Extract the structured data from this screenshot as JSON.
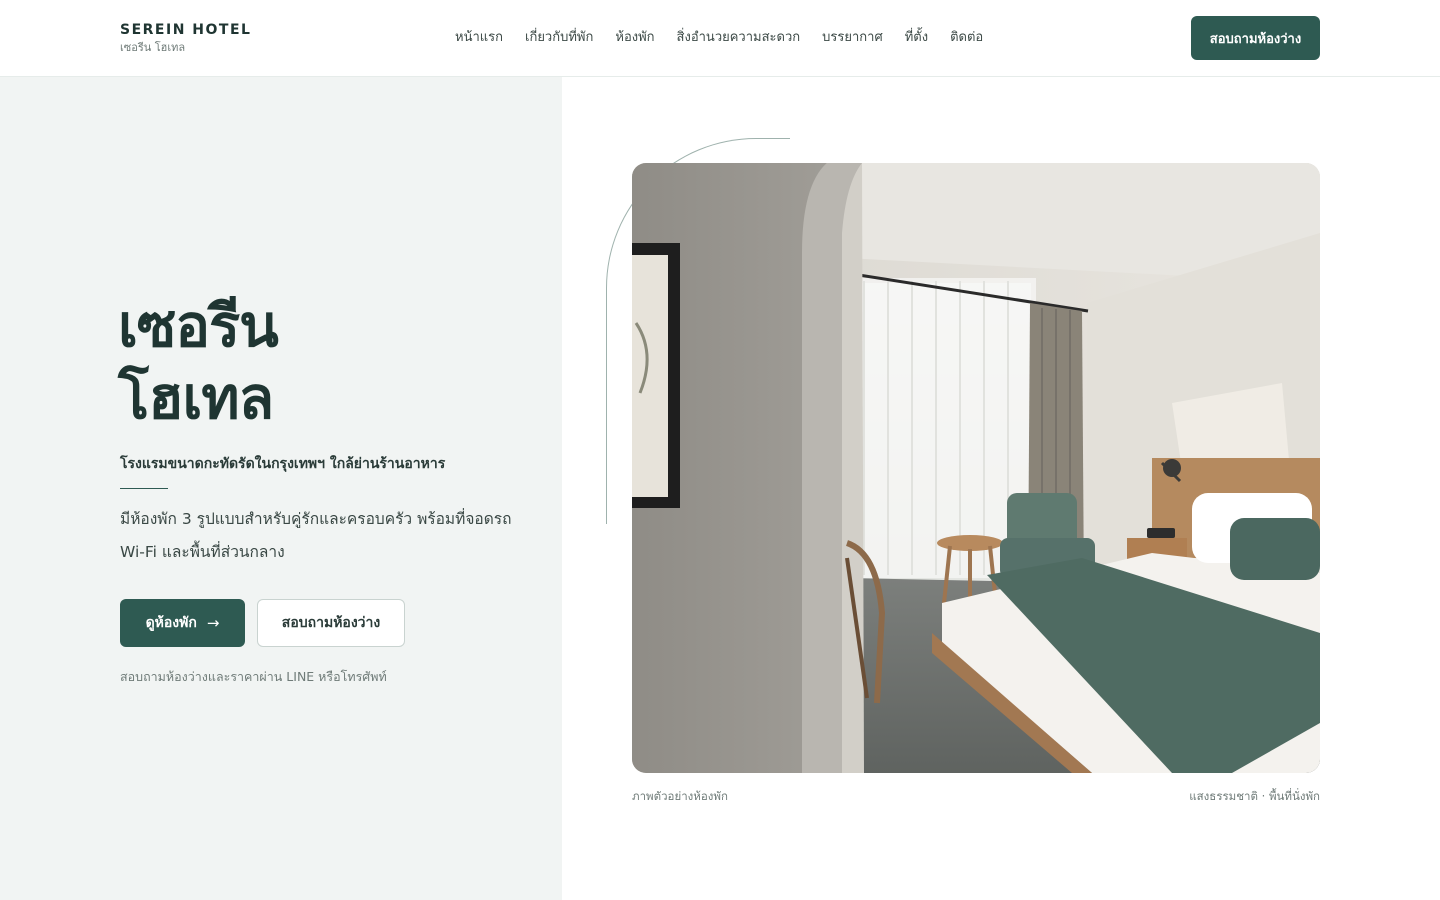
{
  "brand": {
    "name": "SEREIN HOTEL",
    "sub": "เซอรีน โฮเทล"
  },
  "nav": {
    "items": [
      {
        "label": "หน้าแรก"
      },
      {
        "label": "เกี่ยวกับที่พัก"
      },
      {
        "label": "ห้องพัก"
      },
      {
        "label": "สิ่งอำนวยความสะดวก"
      },
      {
        "label": "บรรยากาศ"
      },
      {
        "label": "ที่ตั้ง"
      },
      {
        "label": "ติดต่อ"
      }
    ],
    "cta": "สอบถามห้องว่าง"
  },
  "hero": {
    "title_line1": "เซอรีน",
    "title_line2": "โฮเทล",
    "tagline": "โรงแรมขนาดกะทัดรัดในกรุงเทพฯ ใกล้ย่านร้านอาหาร",
    "desc_line1": "มีห้องพัก 3 รูปแบบสำหรับคู่รักและครอบครัว พร้อมที่จอดรถ",
    "desc_line2": "Wi-Fi และพื้นที่ส่วนกลาง",
    "primary_button": "ดูห้องพัก",
    "secondary_button": "สอบถามห้องว่าง",
    "note": "สอบถามห้องว่างและราคาผ่าน LINE หรือโทรศัพท์"
  },
  "photo": {
    "caption_left": "ภาพตัวอย่างห้องพัก",
    "caption_right": "แสงธรรมชาติ · พื้นที่นั่งพัก"
  },
  "colors": {
    "accent": "#2e5a52",
    "panel": "#f1f4f3",
    "title": "#1f3532"
  },
  "icons": {
    "arrow": "arrow-right-icon"
  }
}
